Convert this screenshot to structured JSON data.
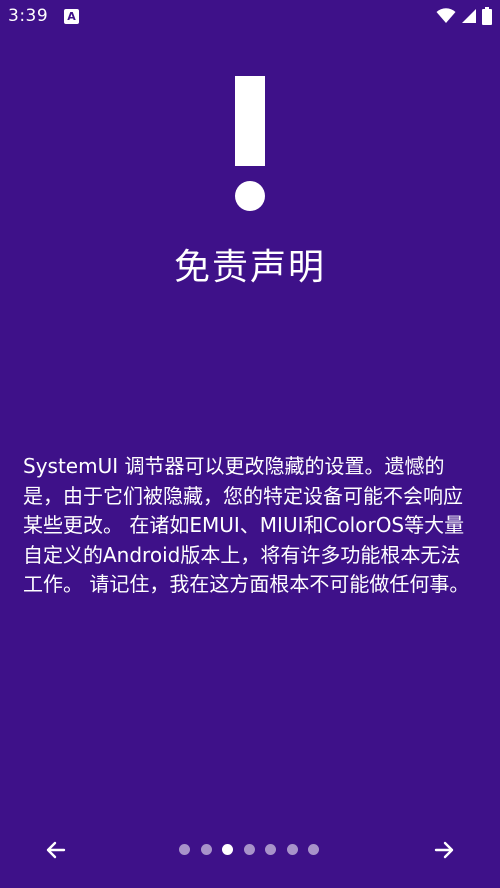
{
  "status_bar": {
    "time": "3:39",
    "a_icon_label": "A"
  },
  "page": {
    "title": "免责声明",
    "body": "SystemUI 调节器可以更改隐藏的设置。遗憾的是，由于它们被隐藏，您的特定设备可能不会响应某些更改。 在诸如EMUI、MIUI和ColorOS等大量自定义的Android版本上，将有许多功能根本无法工作。 请记住，我在这方面根本不可能做任何事。"
  },
  "pager": {
    "dot_count": 7,
    "active_index": 2
  },
  "colors": {
    "background": "#3e1189",
    "foreground": "#ffffff"
  },
  "icons": {
    "warning": "exclamation-icon",
    "prev": "arrow-left-icon",
    "next": "arrow-right-icon"
  }
}
